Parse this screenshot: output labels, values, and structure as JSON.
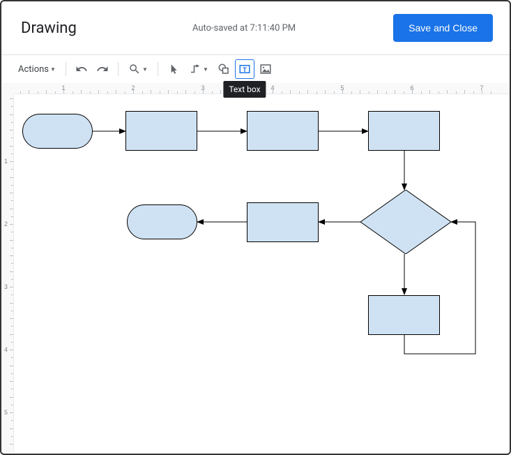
{
  "header": {
    "title": "Drawing",
    "autosave": "Auto-saved at 7:11:40 PM",
    "save_button": "Save and Close"
  },
  "toolbar": {
    "actions": "Actions",
    "undo": "undo-icon",
    "redo": "redo-icon",
    "zoom": "zoom-icon",
    "select": "select-icon",
    "line": "line-icon",
    "shape": "shape-icon",
    "textbox": "textbox-icon",
    "image": "image-icon"
  },
  "tooltip": {
    "textbox": "Text box"
  },
  "ruler": {
    "h": [
      "1",
      "2",
      "3",
      "4",
      "5",
      "6",
      "7"
    ],
    "v": [
      "1",
      "2",
      "3",
      "4",
      "5"
    ]
  },
  "shapes": {
    "fill": "#cfe2f3",
    "stroke": "#000000"
  }
}
